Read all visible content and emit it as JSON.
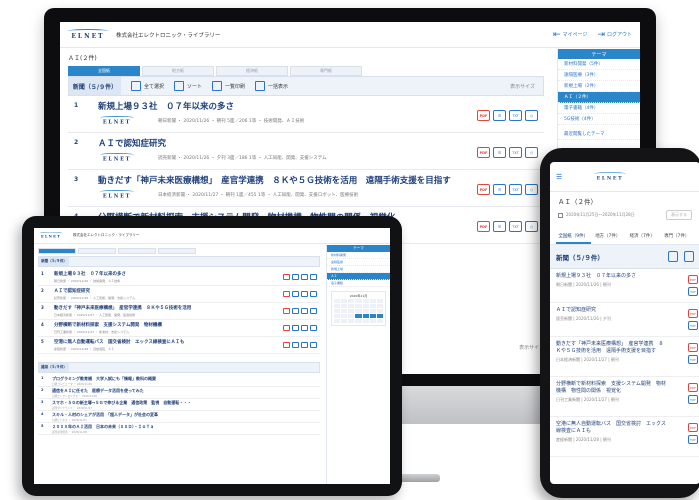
{
  "brand": {
    "logo_text": "ELNET",
    "company": "株式会社エレクトロニック・ライブラリー"
  },
  "desktop": {
    "header_links": [
      "マイページ",
      "ログアウト"
    ],
    "section_title": "ＡＩ(２件)",
    "tabs": [
      "全国紙",
      "地方紙",
      "経済紙",
      "専門紙"
    ],
    "toolbar": {
      "label": "新聞（５/９件）",
      "select_all": "全て選択",
      "sort": "ソート",
      "list_view": "一覧印刷",
      "bulk": "一括表示",
      "size": "表示サイズ"
    },
    "articles": [
      {
        "num": "1",
        "title": "新規上場９３社　０７年以来の多さ",
        "meta": "朝日新聞 ・ 2020/11/26 ・ 朝刊 5面／206 1等 ・ 技術開発、ＡＩ技術"
      },
      {
        "num": "2",
        "title": "ＡＩで認知症研究",
        "meta": "読売新聞 ・ 2020/11/26 ・ 夕刊 3面／186 1等 ・ 人工知能、開発、支援システム"
      },
      {
        "num": "3",
        "title": "動きだす「神戸未来医療構想」　産官学連携　８Ｋや５Ｇ技術を活用　遠隔手術支援を目指す",
        "meta": "日本経済新聞 ・ 2020/11/27 ・ 朝刊 1面／455 1等 ・ 人工知能、開発、支援ロボット、医療技術"
      },
      {
        "num": "4",
        "title": "分野横断で新材料探索　支援システム開発　物材機構　物性間の関係　視覚化",
        "meta": ""
      }
    ],
    "sidebar": {
      "header": "テーマ",
      "items": [
        "新材料開発（5件）",
        "遠隔医療（3件）",
        "新規上場（2件）",
        "ＡＩ（２件）",
        "電子書籍（4件）",
        "5G技術（4件）"
      ],
      "active_index": 3,
      "footer": "最近閲覧したテーマ"
    },
    "bottom_size": "表示サイズ"
  },
  "tablet": {
    "company": "株式会社エレクトロニック・ライブラリー",
    "toolbar_label": "新聞（５/９件）",
    "articles": [
      {
        "num": "1",
        "title": "新規上場９３社　０７年以来の多さ",
        "meta": "朝日新聞 ・ 2020/11/26 ・ 技術開発、ＡＩ技術"
      },
      {
        "num": "2",
        "title": "ＡＩで認知症研究",
        "meta": "読売新聞 ・ 2020/11/26 ・ 人工知能、開発、支援システム"
      },
      {
        "num": "3",
        "title": "動きだす「神戸未来医療構想」　産官学連携　８Ｋや５Ｇ技術を活用",
        "meta": "日本経済新聞 ・ 2020/11/27 ・ 人工知能、開発、医療技術"
      },
      {
        "num": "4",
        "title": "分野横断で新材料探索　支援システム開発　物材機構",
        "meta": "日刊工業新聞 ・ 2020/11/27 ・ 新素材、支援システム"
      },
      {
        "num": "5",
        "title": "空港に無人自動運転バス　国交省検討　エックス線検査にＡＩも",
        "meta": "産経新聞 ・ 2020/11/28 ・ 自動運転、ＡＩ"
      }
    ],
    "magazines_label": "雑誌（５/９件）",
    "magazines": [
      {
        "num": "1",
        "title": "プログラミング教育補　大学入試にも「情報」教科の概要",
        "meta": "日経コンピュータ ・ 2020/11/26"
      },
      {
        "num": "2",
        "title": "通信をＡＩに任せた　医療データ活用を使ってみた",
        "meta": "日経エレクトロニクス ・ 2020/11/26"
      },
      {
        "num": "3",
        "title": "スマホ・５Ｇの新主導→５Ｇで伸びる企業　通信政策　監視　自動運転・・・",
        "meta": "週刊ダイヤモンド ・ 2020/11/27"
      },
      {
        "num": "4",
        "title": "スキル・人材のシェアが活用　「超人データ」が社会の変革",
        "meta": "日経ビジネス ・ 2020/11/27"
      },
      {
        "num": "5",
        "title": "２０ＸＸ年のＡＩ活用　日本の未来（ＳＳＤ）・ＩｏＴａ",
        "meta": "週刊東洋経済 ・ 2020/11/28"
      }
    ],
    "sidebar": {
      "header": "テーマ",
      "items": [
        "新材料開発",
        "遠隔医療",
        "新規上場",
        "ＡＩ",
        "電子書籍"
      ],
      "active_index": 3,
      "calendar_title": "2020年11月"
    }
  },
  "phone": {
    "category": "ＡＩ（２件）",
    "date_range": "2020年11月25日〜2020年11月28日",
    "search_button": "表示する",
    "tabs": [
      "全国紙（9件）",
      "地方（7件）",
      "経済（7件）",
      "専門（7件）"
    ],
    "toolbar_label": "新聞（５/９件）",
    "articles": [
      {
        "title": "新規上場９３社　０７年以来の多さ",
        "meta": "朝日新聞 | 2020/11/26 | 朝刊"
      },
      {
        "title": "ＡＩで認知症研究",
        "meta": "読売新聞 | 2020/11/26 | 夕刊"
      },
      {
        "title": "動きだす「神戸未来医療構想」　産官学連携　８Ｋや５Ｇ技術を活用　遠隔手術支援を目指す",
        "meta": "日本経済新聞 | 2020/11/27 | 朝刊"
      },
      {
        "title": "分野横断で新材料探索　支援システム開発　物材機構　物性間の関係　視覚化",
        "meta": "日刊工業新聞 | 2020/11/27 | 朝刊"
      },
      {
        "title": "空港に無人自動運転バス　国交省検討　エックス線検査にＡＩも",
        "meta": "産経新聞 | 2020/11/28 | 朝刊"
      }
    ]
  },
  "colors": {
    "accent": "#2a86c9",
    "navy": "#1f3f7a",
    "pdf_red": "#e0463f"
  },
  "icons": {
    "pdf": "PDF",
    "text": "TXT"
  }
}
